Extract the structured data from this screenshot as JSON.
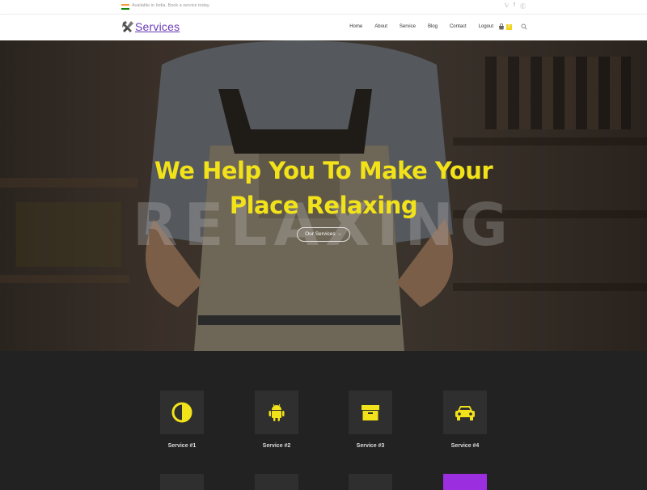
{
  "topbar": {
    "note": "Available in India. Book a service today.",
    "social": [
      "twitter-icon",
      "facebook-icon",
      "skype-icon"
    ]
  },
  "header": {
    "logo_text": "Services",
    "nav": [
      "Home",
      "About",
      "Service",
      "Blog",
      "Contact",
      "Logout"
    ],
    "cart_count": "0"
  },
  "hero": {
    "background_word": "RELAXING",
    "title_line1": "We Help You To Make Your",
    "title_line2": "Place Relaxing",
    "button_label": "Our Services →"
  },
  "services": {
    "items": [
      {
        "label": "Service #1",
        "icon": "contrast-icon"
      },
      {
        "label": "Service #2",
        "icon": "android-icon"
      },
      {
        "label": "Service #3",
        "icon": "archive-icon"
      },
      {
        "label": "Service #4",
        "icon": "car-icon"
      }
    ]
  },
  "colors": {
    "accent": "#f2e21a",
    "brand": "#6b3bb5",
    "purple_tile": "#9b2fe0",
    "dark_bg": "#222222"
  }
}
